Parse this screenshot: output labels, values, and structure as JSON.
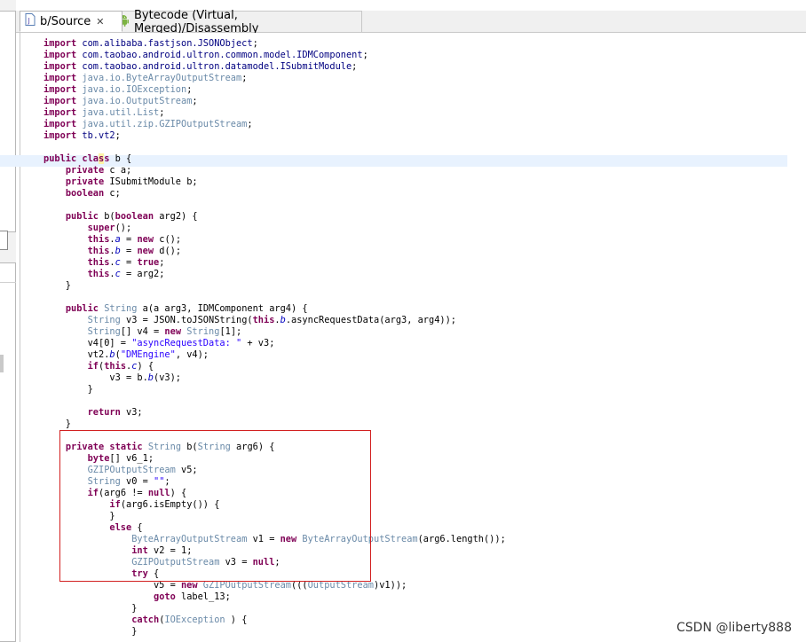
{
  "tabs": [
    {
      "label": "b/Source",
      "active": true,
      "icon": "java-file-icon"
    },
    {
      "label": "Bytecode (Virtual, Merged)/Disassembly",
      "active": false,
      "icon": "android-icon"
    }
  ],
  "tab_close_glyph": "✕",
  "colors": {
    "keyword": "#7f0055",
    "class": "#000080",
    "field": "#0000c0",
    "string": "#2a00ff",
    "highlight": "#e8f2fe",
    "annotation_box": "#d22020"
  },
  "code_lines": [
    "import com.alibaba.fastjson.JSONObject;",
    "import com.taobao.android.ultron.common.model.IDMComponent;",
    "import com.taobao.android.ultron.datamodel.ISubmitModule;",
    "import java.io.ByteArrayOutputStream;",
    "import java.io.IOException;",
    "import java.io.OutputStream;",
    "import java.util.List;",
    "import java.util.zip.GZIPOutputStream;",
    "import tb.vt2;",
    "",
    "public class b {",
    "    private c a;",
    "    private ISubmitModule b;",
    "    boolean c;",
    "",
    "    public b(boolean arg2) {",
    "        super();",
    "        this.a = new c();",
    "        this.b = new d();",
    "        this.c = true;",
    "        this.c = arg2;",
    "    }",
    "",
    "    public String a(a arg3, IDMComponent arg4) {",
    "        String v3 = JSON.toJSONString(this.b.asyncRequestData(arg3, arg4));",
    "        String[] v4 = new String[1];",
    "        v4[0] = \"asyncRequestData: \" + v3;",
    "        vt2.b(\"DMEngine\", v4);",
    "        if(this.c) {",
    "            v3 = b.b(v3);",
    "        }",
    "",
    "        return v3;",
    "    }",
    "",
    "    private static String b(String arg6) {",
    "        byte[] v6_1;",
    "        GZIPOutputStream v5;",
    "        String v0 = \"\";",
    "        if(arg6 != null) {",
    "            if(arg6.isEmpty()) {",
    "            }",
    "            else {",
    "                ByteArrayOutputStream v1 = new ByteArrayOutputStream(arg6.length());",
    "                int v2 = 1;",
    "                GZIPOutputStream v3 = null;",
    "                try {",
    "                    v5 = new GZIPOutputStream(((OutputStream)v1));",
    "                    goto label_13;",
    "                }",
    "                catch(IOException ) {",
    "                }"
  ],
  "watermark": "CSDN @liberty888"
}
